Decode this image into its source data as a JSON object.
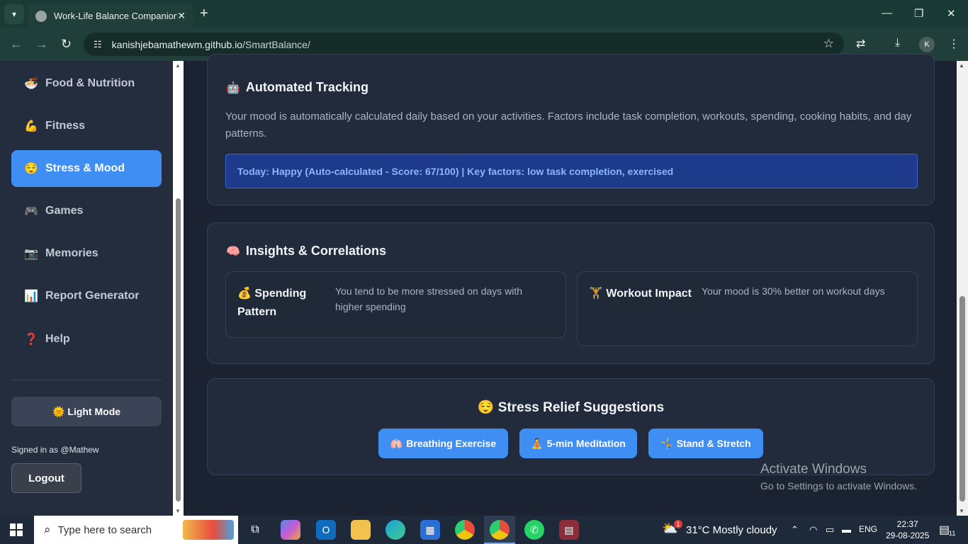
{
  "browser": {
    "tab_title": "Work-Life Balance Companion",
    "url_host": "kanishjebamathewm.github.io",
    "url_path": "/SmartBalance/",
    "profile_initial": "K"
  },
  "sidebar": {
    "items": [
      {
        "label": "Food & Nutrition",
        "icon": "🍜"
      },
      {
        "label": "Fitness",
        "icon": "💪"
      },
      {
        "label": "Stress & Mood",
        "icon": "😌"
      },
      {
        "label": "Games",
        "icon": "🎮"
      },
      {
        "label": "Memories",
        "icon": "📷"
      },
      {
        "label": "Report Generator",
        "icon": "📊"
      },
      {
        "label": "Help",
        "icon": "❓"
      }
    ],
    "active_item": "Stress & Mood",
    "theme_toggle_label": "Light Mode",
    "theme_toggle_icon": "🌞",
    "signed_in_text": "Signed in as @Mathew",
    "logout_label": "Logout"
  },
  "tracking": {
    "title": "Automated Tracking",
    "icon": "🤖",
    "description": "Your mood is automatically calculated daily based on your activities. Factors include task completion, workouts, spending, cooking habits, and day patterns.",
    "today_status": "Today: Happy (Auto-calculated - Score: 67/100) | Key factors: low task completion, exercised"
  },
  "insights": {
    "title": "Insights & Correlations",
    "icon": "🧠",
    "cards": [
      {
        "title": "Spending Pattern",
        "icon": "💰",
        "text": "You tend to be more stressed on days with higher spending"
      },
      {
        "title": "Workout Impact",
        "icon": "🏋",
        "text": "Your mood is 30% better on workout days"
      }
    ]
  },
  "relief": {
    "title": "Stress Relief Suggestions",
    "icon": "😌",
    "buttons": [
      {
        "label": "Breathing Exercise",
        "icon": "🫁"
      },
      {
        "label": "5-min Meditation",
        "icon": "🧘"
      },
      {
        "label": "Stand & Stretch",
        "icon": "🤸"
      }
    ]
  },
  "watermark": {
    "line1": "Activate Windows",
    "line2": "Go to Settings to activate Windows."
  },
  "taskbar": {
    "search_placeholder": "Type here to search",
    "weather": "31°C  Mostly cloudy",
    "weather_badge": "1",
    "language": "ENG",
    "time": "22:37",
    "date": "29-08-2025",
    "notification_count": "11"
  }
}
